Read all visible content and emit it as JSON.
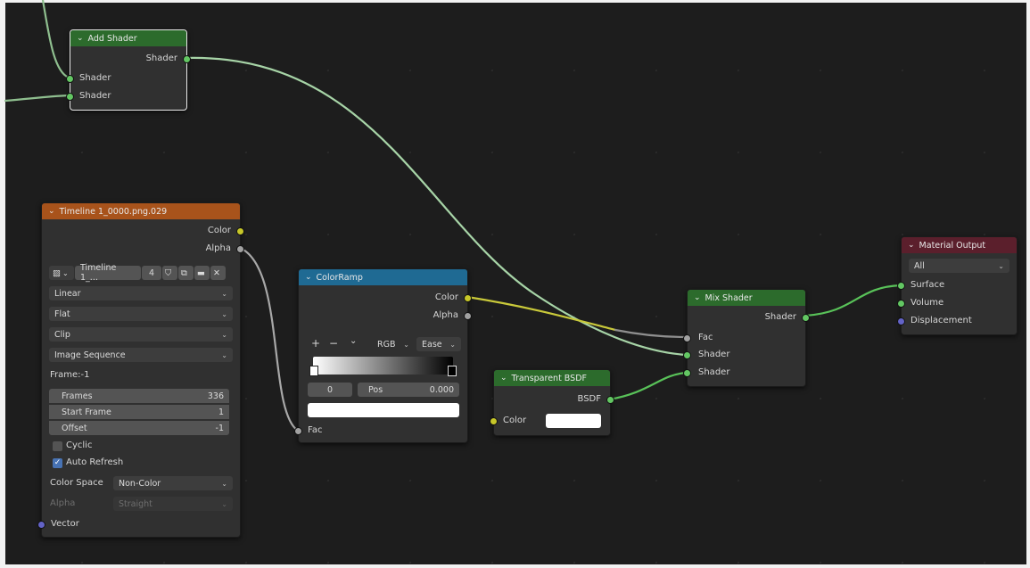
{
  "colors": {
    "shader_socket": "#63c763",
    "color_socket": "#c7c729",
    "float_socket": "#a1a1a1",
    "vector_socket": "#6363c7",
    "header_shader": "#2c6b2c",
    "header_texture": "#a8531b",
    "header_converter": "#1f6a93",
    "header_output": "#5b1f2c"
  },
  "add_shader": {
    "title": "Add Shader",
    "output_shader": "Shader",
    "input_shader_1": "Shader",
    "input_shader_2": "Shader"
  },
  "image_texture": {
    "title": "Timeline 1_0000.png.029",
    "output_color": "Color",
    "output_alpha": "Alpha",
    "image_name": "Timeline 1_...",
    "users": "4",
    "interpolation": "Linear",
    "projection": "Flat",
    "extension": "Clip",
    "source": "Image Sequence",
    "frame_label": "Frame:-1",
    "frames_label": "Frames",
    "frames_value": "336",
    "start_label": "Start Frame",
    "start_value": "1",
    "offset_label": "Offset",
    "offset_value": "-1",
    "cyclic_label": "Cyclic",
    "cyclic": false,
    "auto_refresh_label": "Auto Refresh",
    "auto_refresh": true,
    "color_space_label": "Color Space",
    "color_space": "Non-Color",
    "alpha_label": "Alpha",
    "alpha_mode": "Straight",
    "input_vector": "Vector"
  },
  "color_ramp": {
    "title": "ColorRamp",
    "output_color": "Color",
    "output_alpha": "Alpha",
    "add_btn": "+",
    "remove_btn": "−",
    "menu_btn": "⌄",
    "color_mode": "RGB",
    "interpolation": "Ease",
    "stop_index": "0",
    "pos_label": "Pos",
    "pos_value": "0.000",
    "input_fac": "Fac"
  },
  "transparent_bsdf": {
    "title": "Transparent BSDF",
    "output_bsdf": "BSDF",
    "input_color": "Color"
  },
  "mix_shader": {
    "title": "Mix Shader",
    "output_shader": "Shader",
    "input_fac": "Fac",
    "input_shader_1": "Shader",
    "input_shader_2": "Shader"
  },
  "material_output": {
    "title": "Material Output",
    "target": "All",
    "input_surface": "Surface",
    "input_volume": "Volume",
    "input_displacement": "Displacement"
  }
}
